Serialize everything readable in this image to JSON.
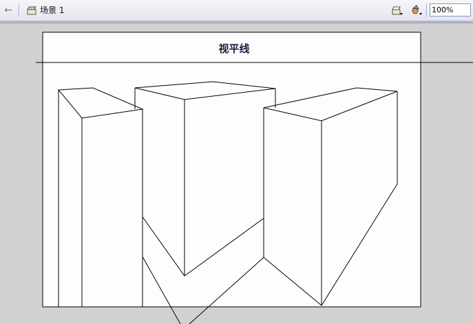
{
  "toolbar": {
    "back_icon": "left-arrow-icon",
    "scene_icon": "clapperboard-icon",
    "scene_label": "场景 1",
    "edit_scene_icon": "clapperboard-dropdown-icon",
    "edit_symbol_icon": "symbol-dropdown-icon",
    "zoom_value": "100%"
  },
  "canvas": {
    "title": "视平线"
  },
  "colors": {
    "stage_bg": "#d1d1d1",
    "canvas_bg": "#fcfdfc",
    "line": "#000000",
    "toolbar_accent": "#b4b4d2"
  }
}
